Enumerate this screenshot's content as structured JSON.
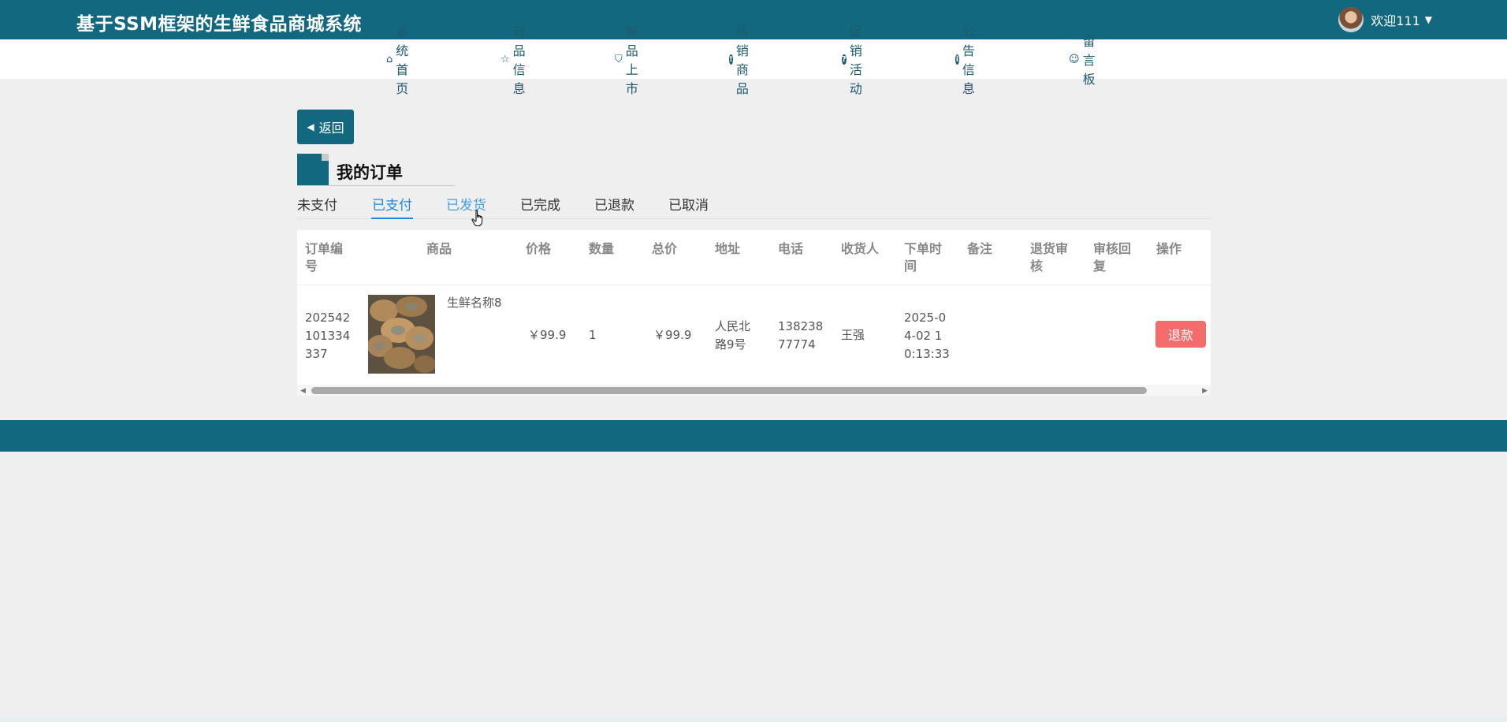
{
  "header": {
    "site_title": "基于SSM框架的生鲜食品商城系统",
    "welcome": "欢迎111"
  },
  "nav": [
    {
      "icon": "home-icon",
      "label": "系统首页"
    },
    {
      "icon": "star-icon",
      "label": "商品信息"
    },
    {
      "icon": "bag-icon",
      "label": "新品上市"
    },
    {
      "icon": "exclamation-icon",
      "label": "热销商品"
    },
    {
      "icon": "question-icon",
      "label": "促销活动"
    },
    {
      "icon": "info-icon",
      "label": "公告信息"
    },
    {
      "icon": "smile-icon",
      "label": "留言板"
    }
  ],
  "back_label": "返回",
  "page_title": "我的订单",
  "tabs": [
    "未支付",
    "已支付",
    "已发货",
    "已完成",
    "已退款",
    "已取消"
  ],
  "active_tab": "已支付",
  "table": {
    "headers": [
      "订单编号",
      "商品",
      "价格",
      "数量",
      "总价",
      "地址",
      "电话",
      "收货人",
      "下单时间",
      "备注",
      "退货审核",
      "审核回复",
      "操作"
    ],
    "rows": [
      {
        "order_no": "202542101334337",
        "product_name": "生鲜名称8",
        "price": "￥99.9",
        "quantity": "1",
        "total": "￥99.9",
        "address": "人民北路9号",
        "phone": "13823877774",
        "receiver": "王强",
        "order_time": "2025-04-02 10:13:33",
        "remark": "",
        "return_review": "",
        "review_reply": "",
        "action_label": "退款"
      }
    ]
  },
  "colors": {
    "primary": "#12687e",
    "nav_text": "#1d5a6e",
    "active_tab": "#1e88e5",
    "danger": "#f56c6c",
    "background": "#efefef"
  }
}
